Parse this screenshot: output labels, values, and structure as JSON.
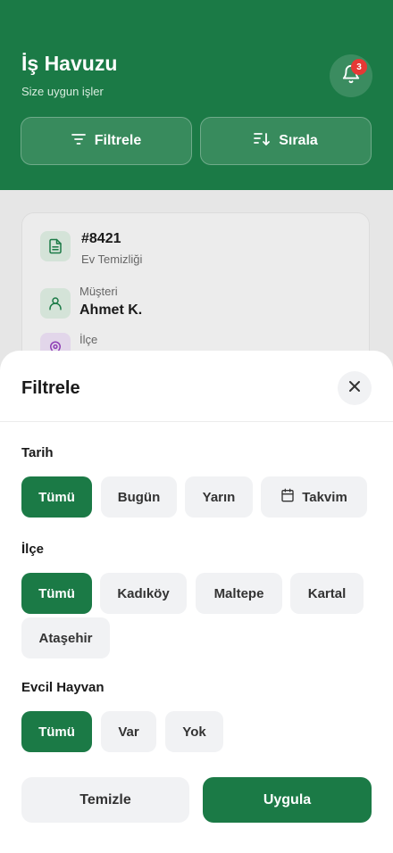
{
  "header": {
    "title": "İş Havuzu",
    "subtitle": "Size uygun işler",
    "notification_count": "3",
    "filter_label": "Filtrele",
    "sort_label": "Sırala"
  },
  "job_card": {
    "id": "#8421",
    "type": "Ev Temizliği",
    "customer_label": "Müşteri",
    "customer_name": "Ahmet K.",
    "district_label": "İlçe"
  },
  "sheet": {
    "title": "Filtrele",
    "sections": {
      "date": {
        "title": "Tarih",
        "options": [
          "Tümü",
          "Bugün",
          "Yarın",
          "Takvim"
        ],
        "selected": "Tümü"
      },
      "district": {
        "title": "İlçe",
        "options": [
          "Tümü",
          "Kadıköy",
          "Maltepe",
          "Kartal",
          "Ataşehir"
        ],
        "selected": "Tümü"
      },
      "pet": {
        "title": "Evcil Hayvan",
        "options": [
          "Tümü",
          "Var",
          "Yok"
        ],
        "selected": "Tümü"
      }
    },
    "clear_label": "Temizle",
    "apply_label": "Uygula"
  },
  "colors": {
    "primary": "#1b7a46",
    "badge": "#e53935",
    "chip_bg": "#f1f2f4"
  }
}
